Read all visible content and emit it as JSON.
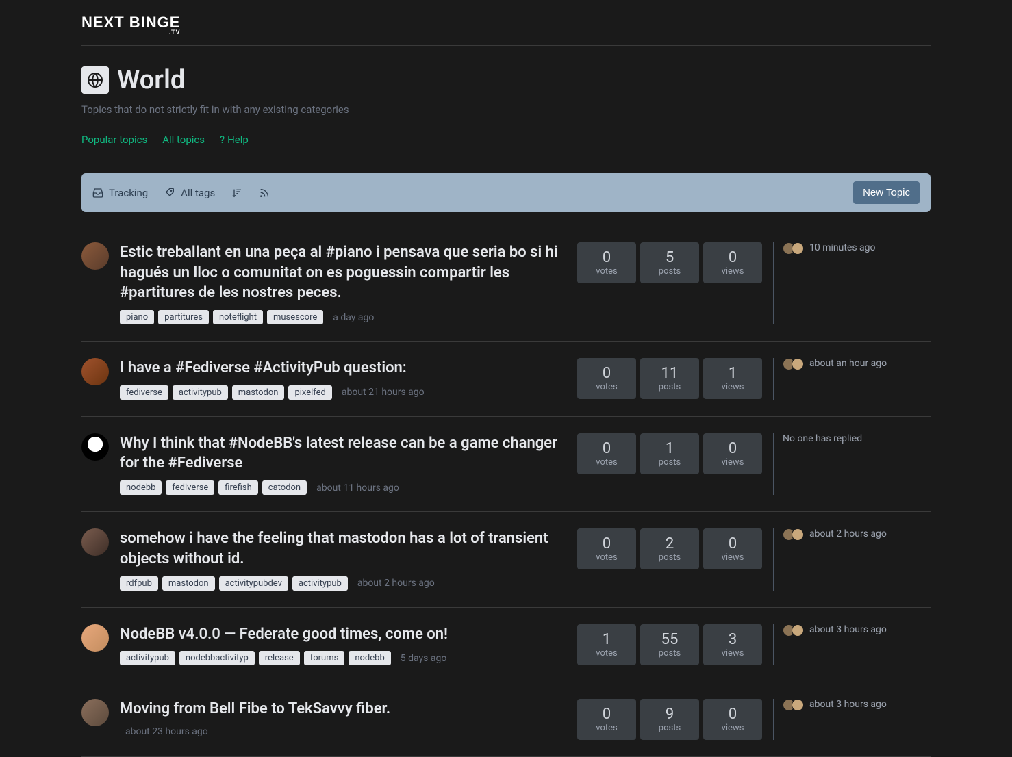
{
  "brand": {
    "name": "NEXT BINGE",
    "sub": ".TV"
  },
  "page": {
    "title": "World",
    "description": "Topics that do not strictly fit in with any existing categories"
  },
  "nav": {
    "popular": "Popular topics",
    "all": "All topics",
    "help": "Help"
  },
  "toolbar": {
    "tracking": "Tracking",
    "alltags": "All tags",
    "newtopic": "New Topic"
  },
  "labels": {
    "votes": "votes",
    "posts": "posts",
    "views": "views",
    "no_reply": "No one has replied"
  },
  "topics": [
    {
      "title": "Estic treballant en una peça al #piano i pensava que seria bo si hi hagués un lloc o comunitat on es poguessin compartir les #partitures de les nostres peces.",
      "tags": [
        "piano",
        "partitures",
        "noteflight",
        "musescore"
      ],
      "time": "a day ago",
      "votes": "0",
      "posts": "5",
      "views": "0",
      "reply_time": "10 minutes ago",
      "has_reply": true,
      "avclass": "av1"
    },
    {
      "title": "I have a #Fediverse #ActivityPub question:",
      "tags": [
        "fediverse",
        "activitypub",
        "mastodon",
        "pixelfed"
      ],
      "time": "about 21 hours ago",
      "votes": "0",
      "posts": "11",
      "views": "1",
      "reply_time": "about an hour ago",
      "has_reply": true,
      "avclass": "av2"
    },
    {
      "title": "Why I think that #NodeBB's latest release can be a game changer for the #Fediverse",
      "tags": [
        "nodebb",
        "fediverse",
        "firefish",
        "catodon"
      ],
      "time": "about 11 hours ago",
      "votes": "0",
      "posts": "1",
      "views": "0",
      "reply_time": "",
      "has_reply": false,
      "avclass": "av3"
    },
    {
      "title": "somehow i have the feeling that mastodon has a lot of transient objects without id.",
      "tags": [
        "rdfpub",
        "mastodon",
        "activitypubdev",
        "activitypub"
      ],
      "time": "about 2 hours ago",
      "votes": "0",
      "posts": "2",
      "views": "0",
      "reply_time": "about 2 hours ago",
      "has_reply": true,
      "avclass": "av4"
    },
    {
      "title": "NodeBB v4.0.0 — Federate good times, come on!",
      "tags": [
        "activitypub",
        "nodebbactivityp",
        "release",
        "forums",
        "nodebb"
      ],
      "time": "5 days ago",
      "votes": "1",
      "posts": "55",
      "views": "3",
      "reply_time": "about 3 hours ago",
      "has_reply": true,
      "avclass": "av5"
    },
    {
      "title": "Moving from Bell Fibe to TekSavvy fiber.",
      "tags": [],
      "time": "about 23 hours ago",
      "votes": "0",
      "posts": "9",
      "views": "0",
      "reply_time": "about 3 hours ago",
      "has_reply": true,
      "avclass": "av6"
    }
  ]
}
